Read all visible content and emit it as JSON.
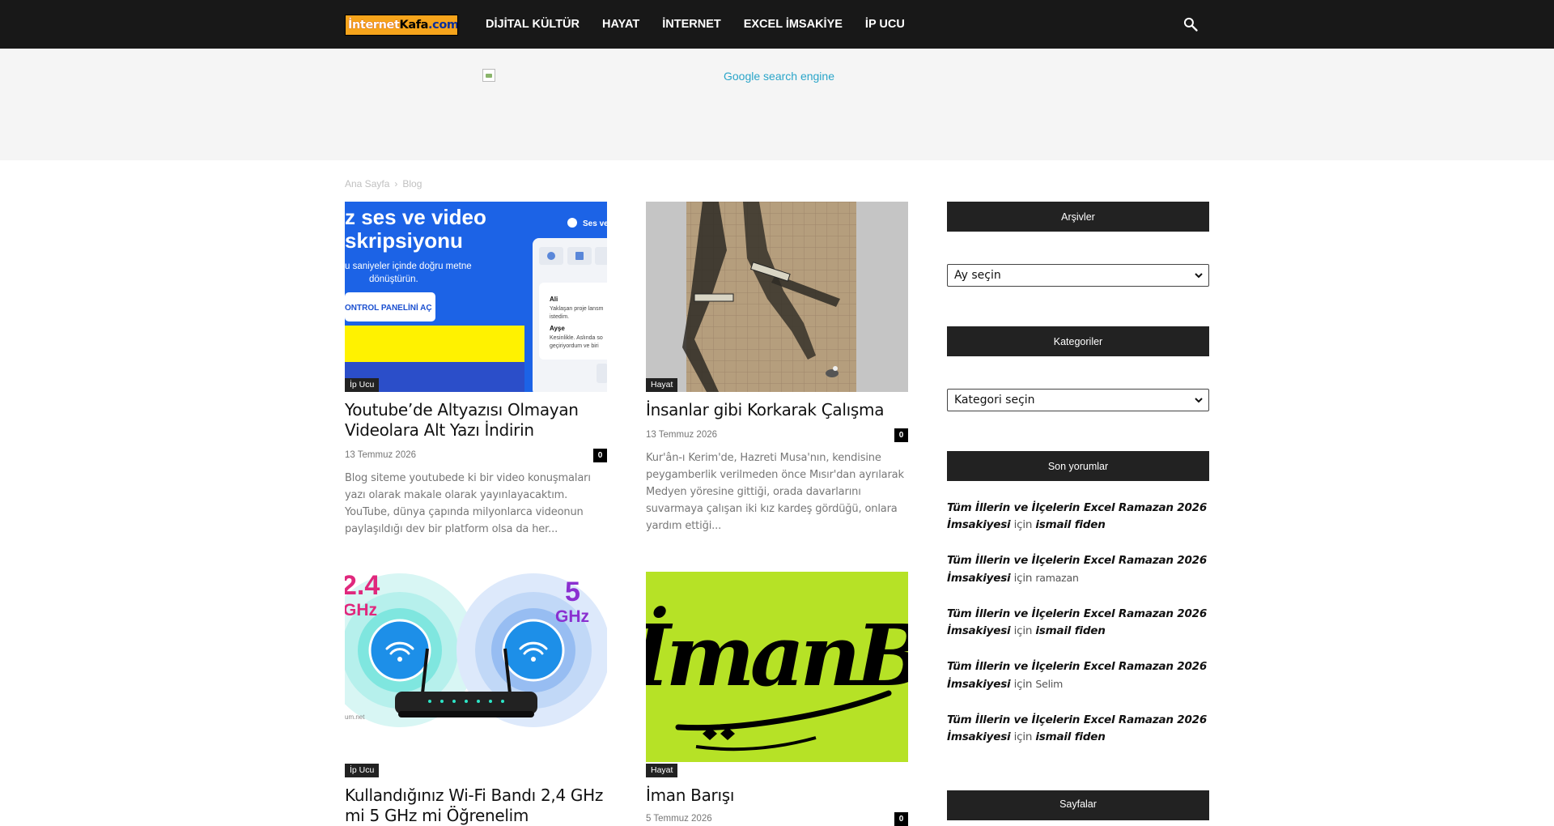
{
  "header": {
    "logo": {
      "part1": "İnternet",
      "part2": "Kafa",
      "part3": ".com"
    },
    "nav": [
      "DİJİTAL KÜLTÜR",
      "HAYAT",
      "İNTERNET",
      "EXCEL İMSAKİYE",
      "İP UCU"
    ],
    "search_icon": "search-icon"
  },
  "ad": {
    "alt_text": "Google search engine"
  },
  "breadcrumb": {
    "home": "Ana Sayfa",
    "separator": "›",
    "current": "Blog"
  },
  "posts": [
    {
      "category": "İp Ucu",
      "title": "Youtube’de Altyazısı Olmayan Videolara Alt Yazı İndirin",
      "date": "13 Temmuz 2026",
      "comments": "0",
      "excerpt": "Blog siteme youtubede ki bir video konuşmaları yazı olarak makale olarak yayınlayacaktım. YouTube, dünya çapında milyonlarca videonun paylaşıldığı dev bir platform olsa da her...",
      "image": {
        "heading1": "z ses ve video",
        "heading2": "skripsiyonu",
        "line1": "u saniyeler içinde doğru metne",
        "line2": "dönüştürün.",
        "button": "ONTROL PANELİNİ AÇ",
        "panel_title": "Ses ve",
        "person1": "Ali",
        "person1_text1": "Yaklaşan proje lansm",
        "person1_text2": "istedim.",
        "person2": "Ayşe",
        "person2_text1": "Kesinlikle. Aslında so",
        "person2_text2": "geçiriyordum ve biri"
      }
    },
    {
      "category": "Hayat",
      "title": "İnsanlar gibi Korkarak Çalışma",
      "date": "13 Temmuz 2026",
      "comments": "0",
      "excerpt": "Kur'ân-ı Kerim'de, Hazreti Musa'nın, kendisine peygamberlik verilmeden önce Mısır'dan ayrılarak Medyen yöresine gittiği, orada davarlarını suvarmaya çalışan iki kız kardeş gördüğü, onlara yardım ettiği..."
    },
    {
      "category": "İp Ucu",
      "title": "Kullandığınız Wi-Fi Bandı 2,4 GHz mi 5 GHz mi Öğrenelim",
      "image": {
        "left_big": "2.4",
        "left_small": "GHz",
        "right_big": "5",
        "right_small": "GHz",
        "watermark": "um.net"
      }
    },
    {
      "category": "Hayat",
      "title": "İman Barışı",
      "date": "5 Temmuz 2026",
      "comments": "0",
      "image": {
        "calligraphy": "İmanBarı"
      }
    }
  ],
  "sidebar": {
    "archives": {
      "title": "Arşivler",
      "select": "Ay seçin"
    },
    "categories": {
      "title": "Kategoriler",
      "select": "Kategori seçin"
    },
    "recent_comments": {
      "title": "Son yorumlar",
      "for_word": "için",
      "items": [
        {
          "post": "Tüm İllerin ve İlçelerin Excel Ramazan 2026 İmsakiyesi",
          "author": "ismail fiden",
          "author_linked": true
        },
        {
          "post": "Tüm İllerin ve İlçelerin Excel Ramazan 2026 İmsakiyesi",
          "author": "ramazan",
          "author_linked": false
        },
        {
          "post": "Tüm İllerin ve İlçelerin Excel Ramazan 2026 İmsakiyesi",
          "author": "ismail fiden",
          "author_linked": true
        },
        {
          "post": "Tüm İllerin ve İlçelerin Excel Ramazan 2026 İmsakiyesi",
          "author": "Selim",
          "author_linked": false
        },
        {
          "post": "Tüm İllerin ve İlçelerin Excel Ramazan 2026 İmsakiyesi",
          "author": "ismail fiden",
          "author_linked": true
        }
      ]
    },
    "pages": {
      "title": "Sayfalar"
    }
  },
  "colors": {
    "topbar": "#181818",
    "accent_link": "#2aa5c9",
    "logo_bg": "#f6a41b",
    "tag_bg": "#222222"
  }
}
